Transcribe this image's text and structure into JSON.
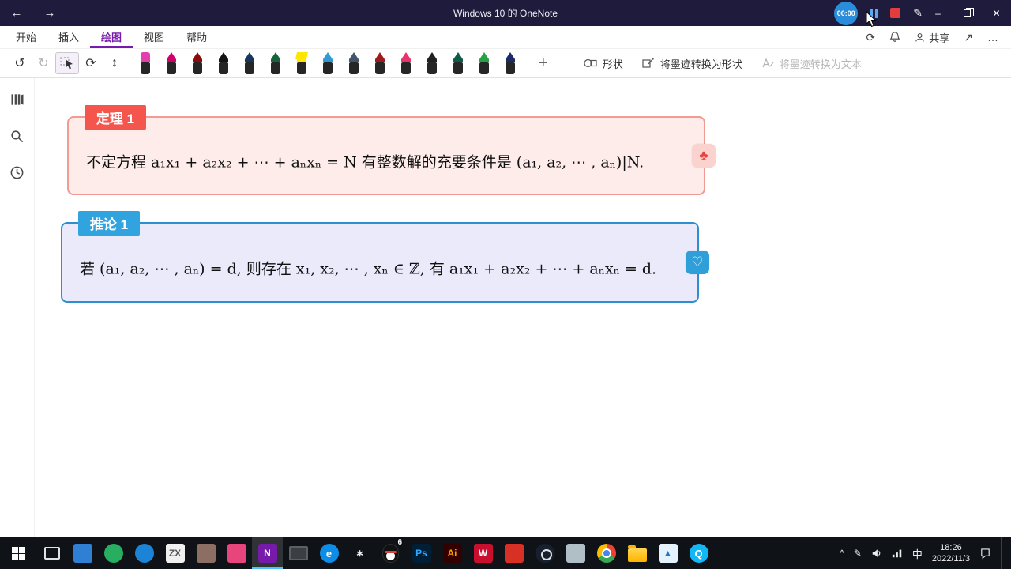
{
  "title_bar": {
    "title": "Windows 10 的 OneNote",
    "recorder_time": "00:00"
  },
  "icons": {
    "back": "←",
    "forward": "→",
    "minimize": "–",
    "close": "✕",
    "undo": "↺",
    "redo": "↻",
    "rotate": "⟳",
    "pan": "↕",
    "add_pen": "+",
    "fullscreen": "↗",
    "more": "…",
    "pencil": "✎",
    "tray_chevron": "^",
    "tray_pen": "✎"
  },
  "ribbon": {
    "tabs": [
      {
        "label": "开始",
        "selected": false
      },
      {
        "label": "插入",
        "selected": false
      },
      {
        "label": "绘图",
        "selected": true
      },
      {
        "label": "视图",
        "selected": false
      },
      {
        "label": "帮助",
        "selected": false
      }
    ],
    "share_label": "共享"
  },
  "toolbar": {
    "shapes_label": "形状",
    "ink_to_shape_label": "将墨迹转换为形状",
    "ink_to_text_label": "将墨迹转换为文本",
    "pens": [
      {
        "type": "eraser",
        "color": "#e33fae"
      },
      {
        "type": "pen",
        "color": "#d4006a"
      },
      {
        "type": "pen",
        "color": "#8e0b0b"
      },
      {
        "type": "pen",
        "color": "#141414"
      },
      {
        "type": "pen",
        "color": "#16365c"
      },
      {
        "type": "pen",
        "color": "#17643c"
      },
      {
        "type": "highlighter",
        "color": "#ffe600"
      },
      {
        "type": "pen",
        "color": "#2e9bd6"
      },
      {
        "type": "pen",
        "color": "#44546a"
      },
      {
        "type": "pen",
        "color": "#9e1b1b"
      },
      {
        "type": "pen",
        "color": "#e8336d"
      },
      {
        "type": "pen",
        "color": "#202020"
      },
      {
        "type": "pen",
        "color": "#0e5c46"
      },
      {
        "type": "pen",
        "color": "#25a244"
      },
      {
        "type": "pen",
        "color": "#1b2a6b"
      }
    ]
  },
  "canvas": {
    "boxes": [
      {
        "label": "定理 1",
        "text": "不定方程 a₁x₁ + a₂x₂ + ⋯ + aₙxₙ = N 有整数解的充要条件是 (a₁, a₂, ⋯ , aₙ)|N.",
        "badge": "♣",
        "border": "#f29b94",
        "label_bg": "#f4564e",
        "bg": "#fdecea",
        "badge_bg": "#fad3cf",
        "badge_fg": "#e8433e"
      },
      {
        "label": "推论 1",
        "text": "若 (a₁, a₂, ⋯ , aₙ) = d, 则存在 x₁, x₂, ⋯ , xₙ ∈ ℤ, 有 a₁x₁ + a₂x₂ + ⋯ + aₙxₙ = d.",
        "badge": "♡",
        "border": "#2e8fd0",
        "label_bg": "#31a3de",
        "bg": "#eaeafb",
        "badge_bg": "#2e9fd8",
        "badge_fg": "#ffffff"
      }
    ]
  },
  "taskbar": {
    "apps": [
      {
        "kind": "taskview",
        "name": "task-view"
      },
      {
        "kind": "square",
        "bg": "#2f7fd4",
        "name": "app-blue"
      },
      {
        "kind": "circle",
        "bg": "#27ae60",
        "name": "app-green-browser"
      },
      {
        "kind": "circle",
        "bg": "#1c84d6",
        "name": "app-blue-circle"
      },
      {
        "kind": "square",
        "bg": "#f0f0f0",
        "fg": "#555555",
        "glyph": "ZX",
        "name": "app-zx"
      },
      {
        "kind": "square",
        "bg": "#8d6e63",
        "name": "app-brown"
      },
      {
        "kind": "square",
        "bg": "#e8457c",
        "name": "app-pink"
      },
      {
        "kind": "square",
        "bg": "#7719aa",
        "fg": "#ffffff",
        "glyph": "N",
        "active": true,
        "name": "onenote"
      },
      {
        "kind": "monitor",
        "name": "app-monitor"
      },
      {
        "kind": "circle",
        "bg": "#0c8ee8",
        "fg": "#ffffff",
        "glyph": "e",
        "name": "edge"
      },
      {
        "kind": "square",
        "bg": "transparent",
        "fg": "#eceff1",
        "glyph": "∗",
        "name": "app-star"
      },
      {
        "kind": "qq",
        "badge": "6",
        "name": "qq"
      },
      {
        "kind": "square",
        "bg": "#001e36",
        "fg": "#31a8ff",
        "glyph": "Ps",
        "name": "photoshop"
      },
      {
        "kind": "square",
        "bg": "#330000",
        "fg": "#ff9a00",
        "glyph": "Ai",
        "name": "illustrator"
      },
      {
        "kind": "square",
        "bg": "#c8102e",
        "fg": "#ffffff",
        "glyph": "W",
        "name": "app-w"
      },
      {
        "kind": "square",
        "bg": "#d93025",
        "name": "app-red"
      },
      {
        "kind": "steam",
        "name": "steam"
      },
      {
        "kind": "square",
        "bg": "#b0bec5",
        "name": "app-gray"
      },
      {
        "kind": "chrome",
        "name": "chrome"
      },
      {
        "kind": "folder",
        "name": "file-explorer"
      },
      {
        "kind": "square",
        "bg": "#e3f2fd",
        "fg": "#1976d2",
        "glyph": "▲",
        "name": "app-photos"
      },
      {
        "kind": "circle",
        "bg": "#12b7f5",
        "fg": "#ffffff",
        "glyph": "Q",
        "name": "app-q"
      }
    ],
    "tray": {
      "ime": "中",
      "time": "18:26",
      "date": "2022/11/3"
    }
  }
}
